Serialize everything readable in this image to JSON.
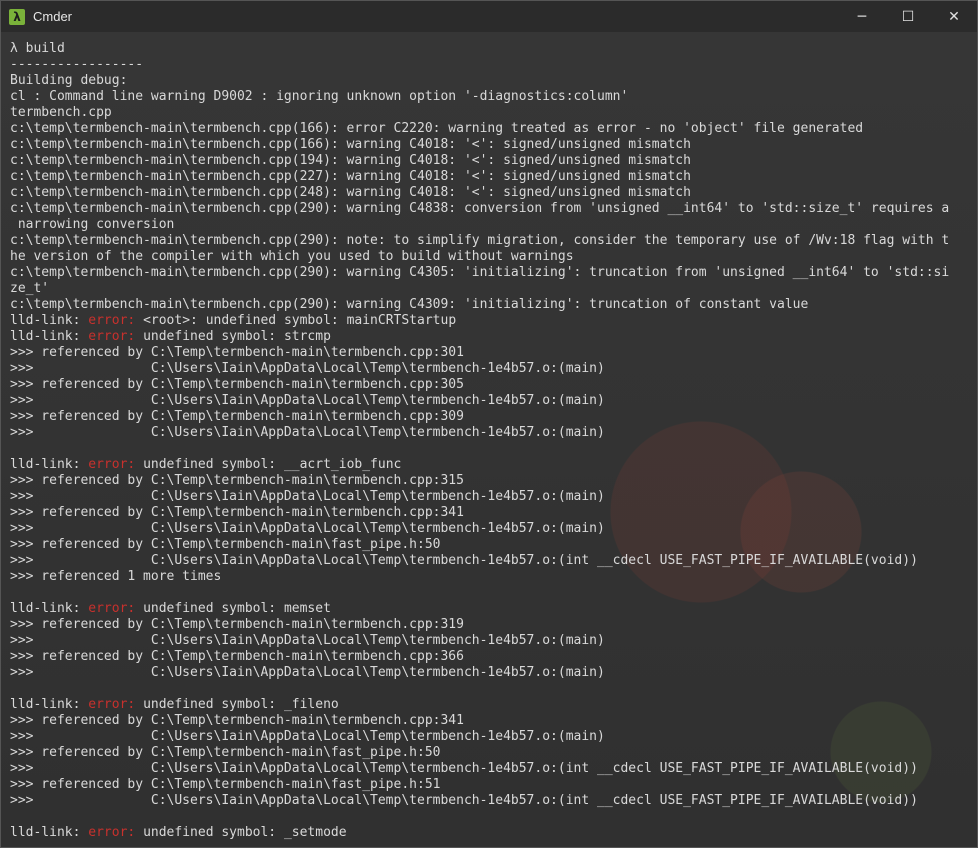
{
  "window": {
    "title": "Cmder",
    "app_icon_glyph": "λ",
    "minimize_glyph": "─",
    "maximize_glyph": "☐",
    "close_glyph": "✕"
  },
  "colors": {
    "terminal_text": "#d9d9d9",
    "error_word": "#c7312d",
    "background": "#303030",
    "titlebar": "#2b2b2b"
  },
  "lines": [
    {
      "text": "λ build"
    },
    {
      "text": "-----------------"
    },
    {
      "text": "Building debug:"
    },
    {
      "text": "cl : Command line warning D9002 : ignoring unknown option '-diagnostics:column'"
    },
    {
      "text": "termbench.cpp"
    },
    {
      "text": "c:\\temp\\termbench-main\\termbench.cpp(166): error C2220: warning treated as error - no 'object' file generated"
    },
    {
      "text": "c:\\temp\\termbench-main\\termbench.cpp(166): warning C4018: '<': signed/unsigned mismatch"
    },
    {
      "text": "c:\\temp\\termbench-main\\termbench.cpp(194): warning C4018: '<': signed/unsigned mismatch"
    },
    {
      "text": "c:\\temp\\termbench-main\\termbench.cpp(227): warning C4018: '<': signed/unsigned mismatch"
    },
    {
      "text": "c:\\temp\\termbench-main\\termbench.cpp(248): warning C4018: '<': signed/unsigned mismatch"
    },
    {
      "text": "c:\\temp\\termbench-main\\termbench.cpp(290): warning C4838: conversion from 'unsigned __int64' to 'std::size_t' requires a"
    },
    {
      "text": " narrowing conversion"
    },
    {
      "text": "c:\\temp\\termbench-main\\termbench.cpp(290): note: to simplify migration, consider the temporary use of /Wv:18 flag with t"
    },
    {
      "text": "he version of the compiler with which you used to build without warnings"
    },
    {
      "text": "c:\\temp\\termbench-main\\termbench.cpp(290): warning C4305: 'initializing': truncation from 'unsigned __int64' to 'std::si"
    },
    {
      "text": "ze_t'"
    },
    {
      "text": "c:\\temp\\termbench-main\\termbench.cpp(290): warning C4309: 'initializing': truncation of constant value"
    },
    {
      "pre": "lld-link: ",
      "err": "error:",
      "post": " <root>: undefined symbol: mainCRTStartup"
    },
    {
      "pre": "lld-link: ",
      "err": "error:",
      "post": " undefined symbol: strcmp"
    },
    {
      "text": ">>> referenced by C:\\Temp\\termbench-main\\termbench.cpp:301"
    },
    {
      "text": ">>>               C:\\Users\\Iain\\AppData\\Local\\Temp\\termbench-1e4b57.o:(main)"
    },
    {
      "text": ">>> referenced by C:\\Temp\\termbench-main\\termbench.cpp:305"
    },
    {
      "text": ">>>               C:\\Users\\Iain\\AppData\\Local\\Temp\\termbench-1e4b57.o:(main)"
    },
    {
      "text": ">>> referenced by C:\\Temp\\termbench-main\\termbench.cpp:309"
    },
    {
      "text": ">>>               C:\\Users\\Iain\\AppData\\Local\\Temp\\termbench-1e4b57.o:(main)"
    },
    {
      "text": ""
    },
    {
      "pre": "lld-link: ",
      "err": "error:",
      "post": " undefined symbol: __acrt_iob_func"
    },
    {
      "text": ">>> referenced by C:\\Temp\\termbench-main\\termbench.cpp:315"
    },
    {
      "text": ">>>               C:\\Users\\Iain\\AppData\\Local\\Temp\\termbench-1e4b57.o:(main)"
    },
    {
      "text": ">>> referenced by C:\\Temp\\termbench-main\\termbench.cpp:341"
    },
    {
      "text": ">>>               C:\\Users\\Iain\\AppData\\Local\\Temp\\termbench-1e4b57.o:(main)"
    },
    {
      "text": ">>> referenced by C:\\Temp\\termbench-main\\fast_pipe.h:50"
    },
    {
      "text": ">>>               C:\\Users\\Iain\\AppData\\Local\\Temp\\termbench-1e4b57.o:(int __cdecl USE_FAST_PIPE_IF_AVAILABLE(void))"
    },
    {
      "text": ">>> referenced 1 more times"
    },
    {
      "text": ""
    },
    {
      "pre": "lld-link: ",
      "err": "error:",
      "post": " undefined symbol: memset"
    },
    {
      "text": ">>> referenced by C:\\Temp\\termbench-main\\termbench.cpp:319"
    },
    {
      "text": ">>>               C:\\Users\\Iain\\AppData\\Local\\Temp\\termbench-1e4b57.o:(main)"
    },
    {
      "text": ">>> referenced by C:\\Temp\\termbench-main\\termbench.cpp:366"
    },
    {
      "text": ">>>               C:\\Users\\Iain\\AppData\\Local\\Temp\\termbench-1e4b57.o:(main)"
    },
    {
      "text": ""
    },
    {
      "pre": "lld-link: ",
      "err": "error:",
      "post": " undefined symbol: _fileno"
    },
    {
      "text": ">>> referenced by C:\\Temp\\termbench-main\\termbench.cpp:341"
    },
    {
      "text": ">>>               C:\\Users\\Iain\\AppData\\Local\\Temp\\termbench-1e4b57.o:(main)"
    },
    {
      "text": ">>> referenced by C:\\Temp\\termbench-main\\fast_pipe.h:50"
    },
    {
      "text": ">>>               C:\\Users\\Iain\\AppData\\Local\\Temp\\termbench-1e4b57.o:(int __cdecl USE_FAST_PIPE_IF_AVAILABLE(void))"
    },
    {
      "text": ">>> referenced by C:\\Temp\\termbench-main\\fast_pipe.h:51"
    },
    {
      "text": ">>>               C:\\Users\\Iain\\AppData\\Local\\Temp\\termbench-1e4b57.o:(int __cdecl USE_FAST_PIPE_IF_AVAILABLE(void))"
    },
    {
      "text": ""
    },
    {
      "pre": "lld-link: ",
      "err": "error:",
      "post": " undefined symbol: _setmode"
    }
  ]
}
